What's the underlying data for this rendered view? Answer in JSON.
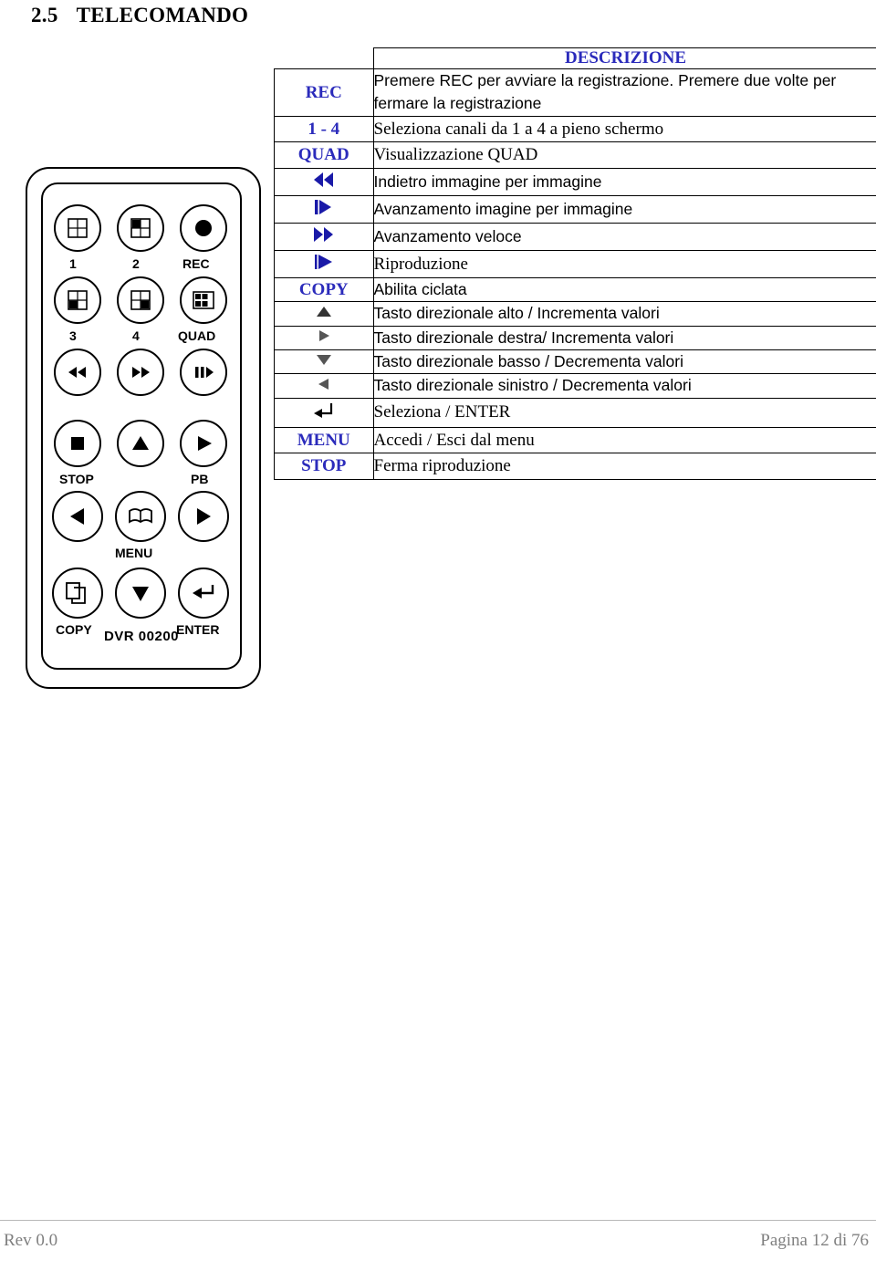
{
  "heading": {
    "number": "2.5",
    "title": "TELECOMANDO"
  },
  "table": {
    "header": {
      "key_blank": "",
      "description": "DESCRIZIONE"
    },
    "rows": [
      {
        "key_type": "text",
        "key": "REC",
        "desc": "Premere REC per avviare la registrazione. Premere due volte per fermare la registrazione",
        "desc_font": "sans"
      },
      {
        "key_type": "text",
        "key": "1 - 4",
        "desc": "Seleziona canali da 1 a 4 a pieno schermo",
        "desc_font": "serif"
      },
      {
        "key_type": "text",
        "key": "QUAD",
        "desc": "Visualizzazione QUAD",
        "desc_font": "serif"
      },
      {
        "key_type": "icon",
        "key_icon": "rewind-step-icon",
        "desc": "Indietro immagine per immagine",
        "desc_font": "sans"
      },
      {
        "key_type": "icon",
        "key_icon": "forward-step-icon",
        "desc": "Avanzamento imagine per immagine",
        "desc_font": "sans"
      },
      {
        "key_type": "icon",
        "key_icon": "fast-forward-icon",
        "desc": "Avanzamento veloce",
        "desc_font": "sans"
      },
      {
        "key_type": "icon",
        "key_icon": "play-icon",
        "desc": "Riproduzione",
        "desc_font": "serif"
      },
      {
        "key_type": "text",
        "key": "COPY",
        "desc": "Abilita ciclata",
        "desc_font": "sans"
      },
      {
        "key_type": "icon",
        "key_icon": "triangle-up-icon",
        "desc": "Tasto direzionale alto / Incrementa valori",
        "desc_font": "sans"
      },
      {
        "key_type": "icon",
        "key_icon": "triangle-right-icon",
        "desc": "Tasto direzionale destra/ Incrementa valori",
        "desc_font": "sans"
      },
      {
        "key_type": "icon",
        "key_icon": "triangle-down-icon",
        "desc": "Tasto direzionale basso / Decrementa valori",
        "desc_font": "sans"
      },
      {
        "key_type": "icon",
        "key_icon": "triangle-left-icon",
        "desc": "Tasto direzionale sinistro / Decrementa valori",
        "desc_font": "sans"
      },
      {
        "key_type": "icon",
        "key_icon": "enter-arrow-icon",
        "desc": "Seleziona / ENTER",
        "desc_font": "serif"
      },
      {
        "key_type": "text",
        "key": "MENU",
        "desc": "Accedi / Esci dal menu",
        "desc_font": "serif"
      },
      {
        "key_type": "text",
        "key": "STOP",
        "desc": "Ferma riproduzione",
        "desc_font": "serif"
      }
    ]
  },
  "remote": {
    "model_label": "DVR 00200",
    "buttons": [
      {
        "label": "1",
        "icon": "quad-grid-icon"
      },
      {
        "label": "2",
        "icon": "quad-grid-icon"
      },
      {
        "label": "REC",
        "icon": "record-dot-icon"
      },
      {
        "label": "3",
        "icon": "quad-grid-icon"
      },
      {
        "label": "4",
        "icon": "quad-grid-icon"
      },
      {
        "label": "QUAD",
        "icon": "multi-grid-icon"
      },
      {
        "label": "",
        "icon": "rewind-icon"
      },
      {
        "label": "",
        "icon": "fast-forward-icon"
      },
      {
        "label": "",
        "icon": "pause-play-icon"
      },
      {
        "label": "STOP",
        "icon": "stop-square-icon"
      },
      {
        "label": "",
        "icon": "triangle-up-icon"
      },
      {
        "label": "PB",
        "icon": "play-icon"
      },
      {
        "label": "",
        "icon": "triangle-left-icon"
      },
      {
        "label": "MENU",
        "icon": "book-icon"
      },
      {
        "label": "",
        "icon": "triangle-right-icon"
      },
      {
        "label": "COPY",
        "icon": "copy-icon"
      },
      {
        "label": "",
        "icon": "triangle-down-icon"
      },
      {
        "label": "ENTER",
        "icon": "enter-arrow-icon"
      }
    ]
  },
  "footer": {
    "revision": "Rev 0.0",
    "page": "Pagina 12 di 76"
  },
  "colors": {
    "key_blue": "#2b2bbb",
    "icon_blue": "#1a1aa8",
    "footer_gray": "#7f7f7f"
  }
}
